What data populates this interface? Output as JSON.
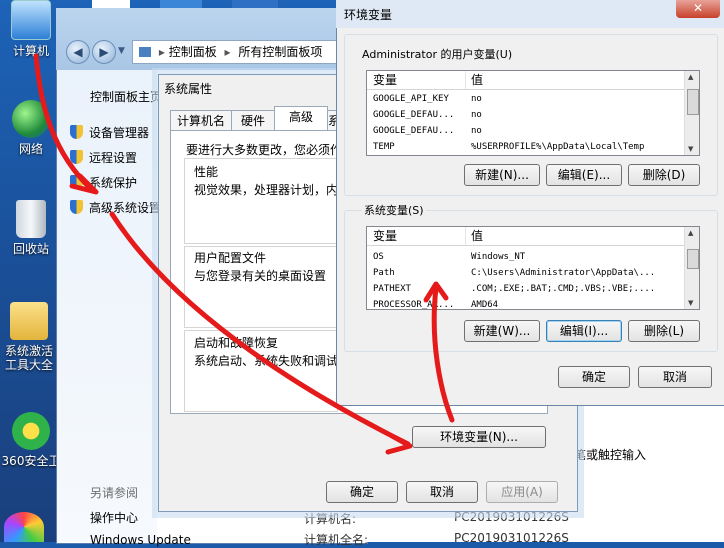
{
  "desktop": {
    "icons": [
      {
        "label": "计算机"
      },
      {
        "label": "网络"
      },
      {
        "label": "回收站"
      },
      {
        "label": "系统激活工具大全"
      },
      {
        "label": "360安全卫"
      }
    ]
  },
  "control_panel": {
    "breadcrumb": [
      "控制面板",
      "所有控制面板项"
    ],
    "home_link": "控制面板主页",
    "links": [
      "设备管理器",
      "远程设置",
      "系统保护",
      "高级系统设置"
    ],
    "see_also": "另请参阅",
    "see_also_links": [
      "操作中心",
      "Windows Update"
    ],
    "info_rows": [
      {
        "label": "计算机名:",
        "value": "PC201903101226S"
      },
      {
        "label": "计算机全名:",
        "value": "PC201903101226S"
      }
    ],
    "partial_text": "笔或触控输入"
  },
  "system_properties": {
    "title": "系统属性",
    "tabs": [
      "计算机名",
      "硬件",
      "高级",
      "系"
    ],
    "intro": "要进行大多数更改，您必须作",
    "groups": [
      {
        "title": "性能",
        "desc": "视觉效果，处理器计划，内"
      },
      {
        "title": "用户配置文件",
        "desc": "与您登录有关的桌面设置"
      },
      {
        "title": "启动和故障恢复",
        "desc": "系统启动、系统失败和调试"
      }
    ],
    "env_button": "环境变量(N)...",
    "ok": "确定",
    "cancel": "取消",
    "apply": "应用(A)"
  },
  "environment_variables": {
    "title": "环境变量",
    "user_label": "Administrator 的用户变量(U)",
    "columns": [
      "变量",
      "值"
    ],
    "user_vars": [
      {
        "name": "GOOGLE_API_KEY",
        "value": "no"
      },
      {
        "name": "GOOGLE_DEFAU...",
        "value": "no"
      },
      {
        "name": "GOOGLE_DEFAU...",
        "value": "no"
      },
      {
        "name": "TEMP",
        "value": "%USERPROFILE%\\AppData\\Local\\Temp"
      }
    ],
    "system_label": "系统变量(S)",
    "system_vars": [
      {
        "name": "OS",
        "value": "Windows_NT"
      },
      {
        "name": "Path",
        "value": "C:\\Users\\Administrator\\AppData\\..."
      },
      {
        "name": "PATHEXT",
        "value": ".COM;.EXE;.BAT;.CMD;.VBS;.VBE;...."
      },
      {
        "name": "PROCESSOR_AR...",
        "value": "AMD64"
      }
    ],
    "user_buttons": [
      "新建(N)...",
      "编辑(E)...",
      "删除(D)"
    ],
    "system_buttons": [
      "新建(W)...",
      "编辑(I)...",
      "删除(L)"
    ],
    "ok": "确定",
    "cancel": "取消"
  },
  "colors": {
    "annotation": "#e51a1a",
    "desktop": "#1b5aa8"
  }
}
